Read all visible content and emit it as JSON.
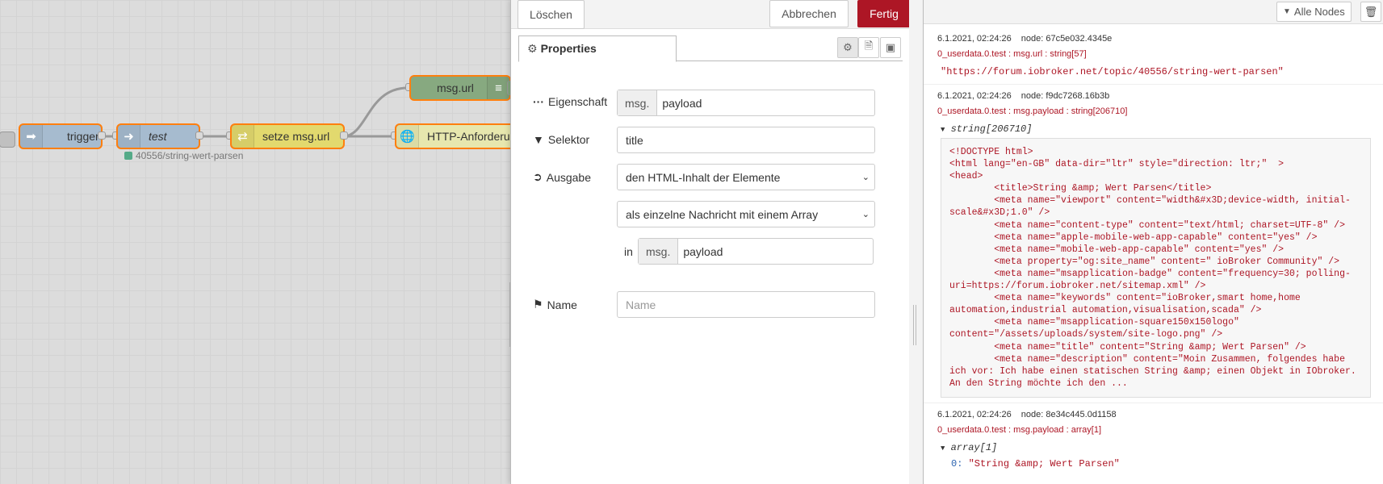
{
  "workspace": {
    "nodes": {
      "trigger": "trigger",
      "test": "test",
      "setze": "setze msg.url",
      "msgurl": "msg.url",
      "http": "HTTP-Anforderung"
    },
    "status_text": "40556/string-wert-parsen"
  },
  "tray": {
    "delete_label": "Löschen",
    "cancel_label": "Abbrechen",
    "done_label": "Fertig",
    "tab_label": "Properties",
    "fields": {
      "property_label": "Eigenschaft",
      "property_prefix": "msg.",
      "property_value": "payload",
      "selector_label": "Selektor",
      "selector_value": "title",
      "output_label": "Ausgabe",
      "output_value": "den HTML-Inhalt der Elemente",
      "output_mode_value": "als einzelne Nachricht mit einem Array",
      "in_label": "in",
      "in_prefix": "msg.",
      "in_value": "payload",
      "name_label": "Name",
      "name_placeholder": "Name"
    }
  },
  "sidebar": {
    "filter_label": "Alle Nodes",
    "messages": [
      {
        "time": "6.1.2021, 02:24:26",
        "node": "node: 67c5e032.4345e",
        "topic": "0_userdata.0.test : msg.url : string[57]",
        "value": "\"https://forum.iobroker.net/topic/40556/string-wert-parsen\""
      },
      {
        "time": "6.1.2021, 02:24:26",
        "node": "node: f9dc7268.16b3b",
        "topic": "0_userdata.0.test : msg.payload : string[206710]",
        "tree": "string[206710]",
        "code": "<!DOCTYPE html>\n<html lang=\"en-GB\" data-dir=\"ltr\" style=\"direction: ltr;\"  >\n<head>\n\t<title>String &amp; Wert Parsen</title>\n\t<meta name=\"viewport\" content=\"width&#x3D;device-width, initial-scale&#x3D;1.0\" />\n\t<meta name=\"content-type\" content=\"text/html; charset=UTF-8\" />\n\t<meta name=\"apple-mobile-web-app-capable\" content=\"yes\" />\n\t<meta name=\"mobile-web-app-capable\" content=\"yes\" />\n\t<meta property=\"og:site_name\" content=\" ioBroker Community\" />\n\t<meta name=\"msapplication-badge\" content=\"frequency=30; polling-uri=https://forum.iobroker.net/sitemap.xml\" />\n\t<meta name=\"keywords\" content=\"ioBroker,smart home,home automation,industrial automation,visualisation,scada\" />\n\t<meta name=\"msapplication-square150x150logo\" content=\"/assets/uploads/system/site-logo.png\" />\n\t<meta name=\"title\" content=\"String &amp; Wert Parsen\" />\n\t<meta name=\"description\" content=\"Moin Zusammen, folgendes habe ich vor: Ich habe einen statischen String &amp; einen Objekt in IObroker. An den String möchte ich den ..."
      },
      {
        "time": "6.1.2021, 02:24:26",
        "node": "node: 8e34c445.0d1158",
        "topic": "0_userdata.0.test : msg.payload : array[1]",
        "tree": "array[1]",
        "item_index": "0:",
        "item_value": "\"String &amp; Wert Parsen\""
      }
    ]
  }
}
